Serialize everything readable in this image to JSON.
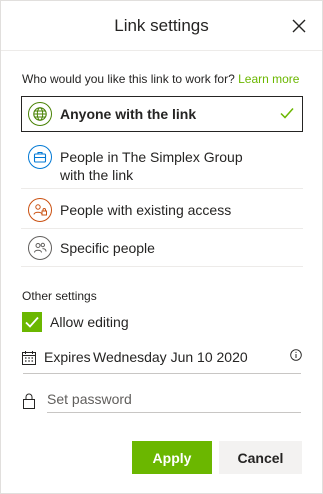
{
  "dialog": {
    "title": "Link settings",
    "close_icon": "close-icon"
  },
  "question": {
    "text": "Who would you like this link to work for?",
    "learn_more": "Learn more"
  },
  "options": [
    {
      "label": "Anyone with the link",
      "icon": "globe-icon",
      "color": "#498205",
      "selected": true
    },
    {
      "label_line1": "People in The Simplex Group",
      "label_line2": "with the link",
      "icon": "briefcase-icon",
      "color": "#0078d4",
      "selected": false
    },
    {
      "label": "People with existing access",
      "icon": "people-lock-icon",
      "color": "#ca5010",
      "selected": false
    },
    {
      "label": "Specific people",
      "icon": "people-icon",
      "color": "#605e5c",
      "selected": false
    }
  ],
  "other_settings": {
    "title": "Other settings",
    "allow_editing": {
      "label": "Allow editing",
      "checked": true
    },
    "expires": {
      "label": "Expires",
      "value": "Wednesday Jun 10 2020",
      "icon": "calendar-icon",
      "info_icon": "info-icon"
    },
    "password": {
      "placeholder": "Set password",
      "value": "",
      "icon": "lock-icon"
    }
  },
  "buttons": {
    "apply": "Apply",
    "cancel": "Cancel"
  },
  "colors": {
    "accent": "#6bb700",
    "text": "#252423"
  }
}
